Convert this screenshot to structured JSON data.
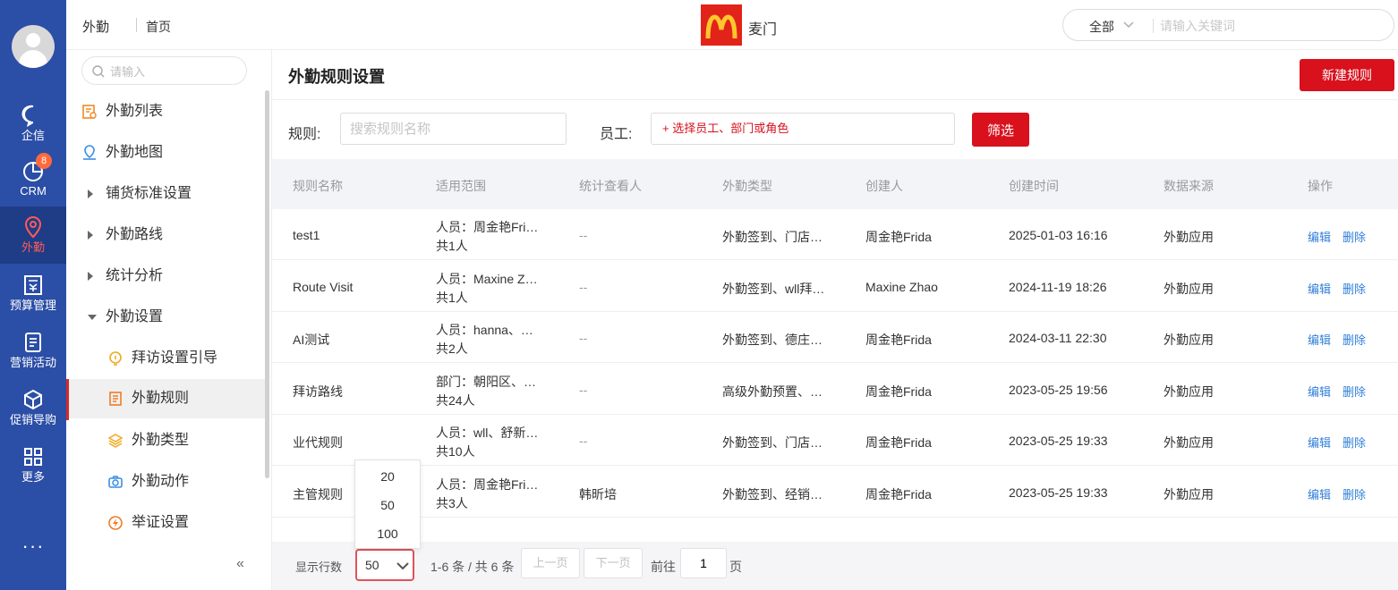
{
  "rail": {
    "items": [
      {
        "label": "企信",
        "icon": "chat-icon"
      },
      {
        "label": "CRM",
        "icon": "pie-chart-icon",
        "badge": "8"
      },
      {
        "label": "外勤",
        "icon": "location-pin-icon",
        "active": true
      },
      {
        "label": "预算管理",
        "icon": "budget-icon"
      },
      {
        "label": "营销活动",
        "icon": "marketing-icon"
      },
      {
        "label": "促销导购",
        "icon": "box-icon"
      },
      {
        "label": "更多",
        "icon": "grid-icon"
      }
    ],
    "more": "···"
  },
  "header": {
    "module": "外勤",
    "home": "首页",
    "brand_name": "麦门",
    "brand_color": "#e2231a",
    "search_scope": "全部",
    "search_placeholder": "请输入关键词"
  },
  "sidebar": {
    "search_placeholder": "请输入",
    "items": [
      {
        "label": "外勤列表",
        "icon": "list-doc-icon"
      },
      {
        "label": "外勤地图",
        "icon": "map-pin-icon"
      },
      {
        "label": "铺货标准设置",
        "expandable": true
      },
      {
        "label": "外勤路线",
        "expandable": true
      },
      {
        "label": "统计分析",
        "expandable": true
      },
      {
        "label": "外勤设置",
        "expanded": true
      },
      {
        "label": "拜访设置引导",
        "icon": "bulb-icon"
      },
      {
        "label": "外勤规则",
        "icon": "rule-doc-icon",
        "active": true
      },
      {
        "label": "外勤类型",
        "icon": "layers-icon"
      },
      {
        "label": "外勤动作",
        "icon": "camera-icon"
      },
      {
        "label": "举证设置",
        "icon": "lightning-icon"
      }
    ],
    "collapse": "«"
  },
  "main": {
    "title": "外勤规则设置",
    "new_button": "新建规则",
    "filter": {
      "rule_label": "规则:",
      "rule_placeholder": "搜索规则名称",
      "employee_label": "员工:",
      "employee_placeholder": "+ 选择员工、部门或角色",
      "filter_button": "筛选"
    },
    "table": {
      "columns": [
        "规则名称",
        "适用范围",
        "统计查看人",
        "外勤类型",
        "创建人",
        "创建时间",
        "数据来源",
        "操作"
      ],
      "rows": [
        {
          "name": "test1",
          "scope": "人员：周金艳Fri…",
          "count": "共1人",
          "viewer": "--",
          "type": "外勤签到、门店…",
          "creator": "周金艳Frida",
          "time": "2025-01-03 16:16",
          "source": "外勤应用",
          "edit": "编辑",
          "delete": "删除"
        },
        {
          "name": "Route Visit",
          "scope": "人员：Maxine Z…",
          "count": "共1人",
          "viewer": "--",
          "type": "外勤签到、wll拜…",
          "creator": "Maxine Zhao",
          "time": "2024-11-19 18:26",
          "source": "外勤应用",
          "edit": "编辑",
          "delete": "删除"
        },
        {
          "name": "AI测试",
          "scope": "人员：hanna、…",
          "count": "共2人",
          "viewer": "--",
          "type": "外勤签到、德庄…",
          "creator": "周金艳Frida",
          "time": "2024-03-11 22:30",
          "source": "外勤应用",
          "edit": "编辑",
          "delete": "删除"
        },
        {
          "name": "拜访路线",
          "scope": "部门：朝阳区、…",
          "count": "共24人",
          "viewer": "--",
          "type": "高级外勤预置、…",
          "creator": "周金艳Frida",
          "time": "2023-05-25 19:56",
          "source": "外勤应用",
          "edit": "编辑",
          "delete": "删除"
        },
        {
          "name": "业代规则",
          "scope": "人员：wll、舒新…",
          "count": "共10人",
          "viewer": "--",
          "type": "外勤签到、门店…",
          "creator": "周金艳Frida",
          "time": "2023-05-25 19:33",
          "source": "外勤应用",
          "edit": "编辑",
          "delete": "删除"
        },
        {
          "name": "主管规则",
          "scope": "人员：周金艳Fri…",
          "count": "共3人",
          "viewer": "韩昕培",
          "type": "外勤签到、经销…",
          "creator": "周金艳Frida",
          "time": "2023-05-25 19:33",
          "source": "外勤应用",
          "edit": "编辑",
          "delete": "删除"
        }
      ]
    },
    "pager": {
      "rows_label": "显示行数",
      "page_size": "50",
      "page_size_options": [
        "20",
        "50",
        "100"
      ],
      "range": "1-6 条 / 共 6 条",
      "prev": "上一页",
      "next": "下一页",
      "goto": "前往",
      "page": "1",
      "page_unit": "页"
    }
  },
  "colors": {
    "rail": "#2b4ea6",
    "accent_red": "#d8111d",
    "link_blue": "#2f7fd8"
  }
}
